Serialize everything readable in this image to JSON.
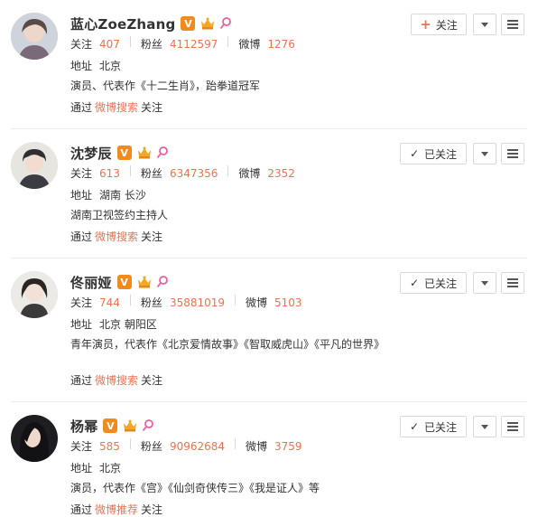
{
  "labels": {
    "follow": "关注",
    "fans": "粉丝",
    "weibo": "微博",
    "address": "地址",
    "via_prefix": "通过",
    "via_suffix": "关注"
  },
  "buttons": {
    "follow": "关注",
    "following": "已关注"
  },
  "users": [
    {
      "name": "蓝心ZoeZhang",
      "follow_count": "407",
      "fans_count": "4112597",
      "weibo_count": "1276",
      "address": "北京",
      "bio": "演员、代表作《十二生肖》，跆拳道冠军",
      "via": "微博搜索",
      "button": "关注"
    },
    {
      "name": "沈梦辰",
      "follow_count": "613",
      "fans_count": "6347356",
      "weibo_count": "2352",
      "address": "湖南 长沙",
      "bio": "湖南卫视签约主持人",
      "via": "微博搜索",
      "button": "已关注"
    },
    {
      "name": "佟丽娅",
      "follow_count": "744",
      "fans_count": "35881019",
      "weibo_count": "5103",
      "address": "北京 朝阳区",
      "bio": "青年演员，代表作《北京爱情故事》《智取威虎山》《平凡的世界》",
      "via": "微博搜索",
      "button": "已关注"
    },
    {
      "name": "杨幂",
      "follow_count": "585",
      "fans_count": "90962684",
      "weibo_count": "3759",
      "address": "北京",
      "bio": "演员，代表作《宫》《仙剑奇侠传三》《我是证人》等",
      "via": "微博推荐",
      "button": "已关注"
    }
  ],
  "colors": {
    "accent": "#eb7350",
    "verified_badge": "#f38a1e",
    "divider": "#ececec"
  },
  "icons": {
    "verified": "V",
    "follow_plus": "+",
    "following_check": "✓"
  }
}
